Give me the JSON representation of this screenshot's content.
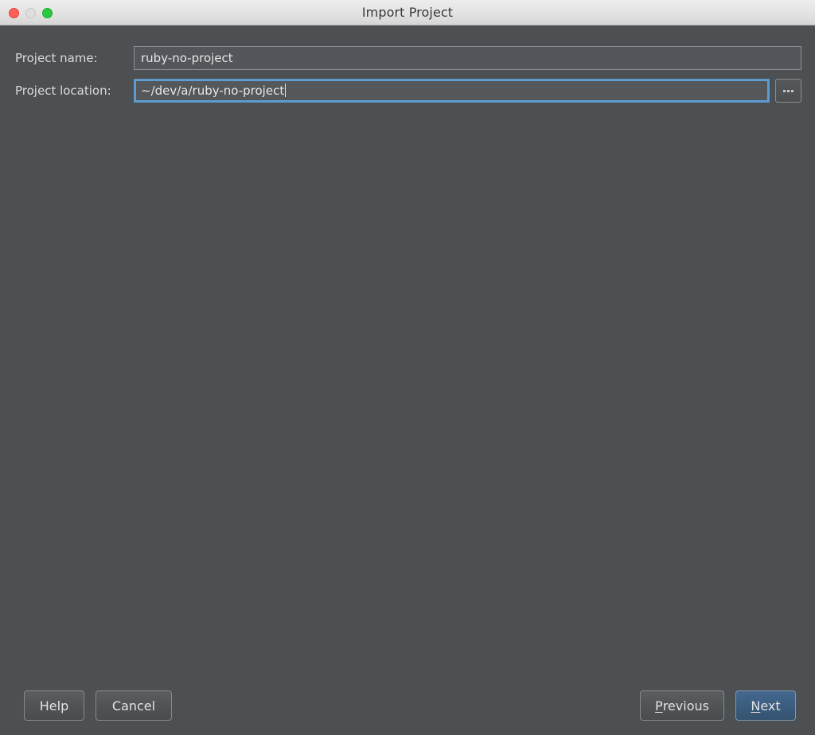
{
  "window": {
    "title": "Import Project",
    "traffic_lights": [
      {
        "name": "close",
        "color": "#ff5f57"
      },
      {
        "name": "minimize",
        "color": "#dedede"
      },
      {
        "name": "maximize",
        "color": "#28c940"
      }
    ]
  },
  "form": {
    "project_name": {
      "label": "Project name:",
      "value": "ruby-no-project",
      "placeholder": ""
    },
    "project_location": {
      "label": "Project location:",
      "value": "~/dev/a/ruby-no-project",
      "placeholder": "",
      "focused": true,
      "browse_label": "..."
    }
  },
  "footer": {
    "help_label": "Help",
    "cancel_label": "Cancel",
    "previous_mnemonic": "P",
    "previous_rest": "revious",
    "next_mnemonic": "N",
    "next_rest": "ext"
  },
  "colors": {
    "body_background": "#4d5052",
    "titlebar_top": "#ededed",
    "titlebar_bottom": "#d6d6d6",
    "label_text": "#dadada",
    "field_background": "#55585a",
    "focus_ring": "#5b9ed6",
    "default_button": "#3b5c7d"
  }
}
